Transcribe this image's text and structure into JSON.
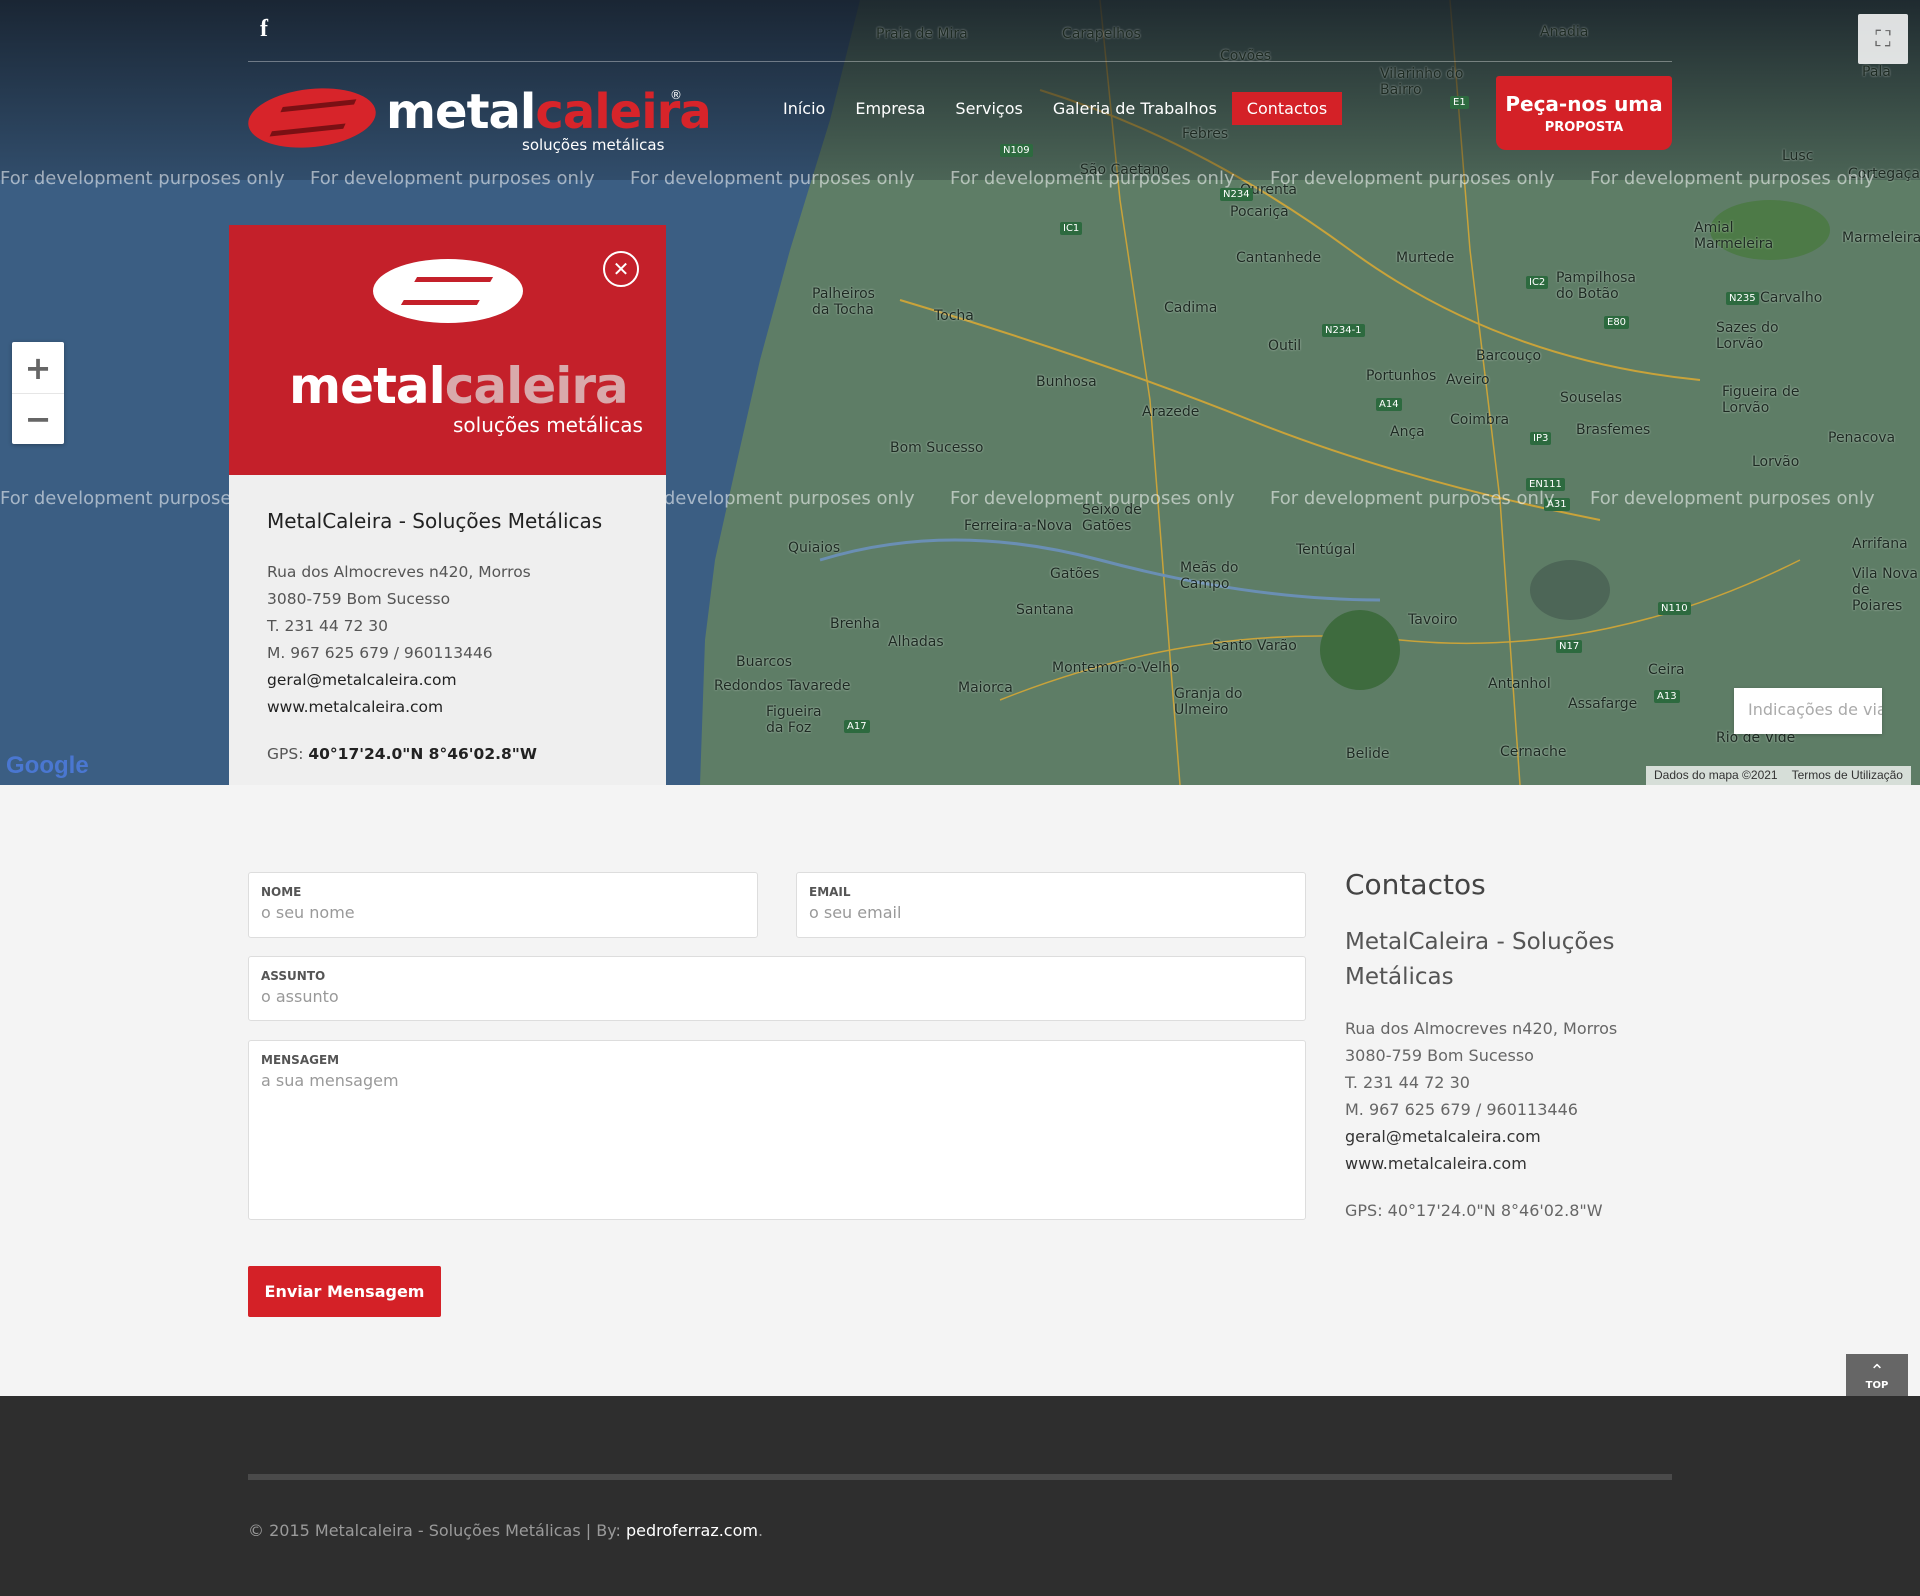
{
  "topbar": {
    "facebook_icon": "f"
  },
  "logo": {
    "word1": "metal",
    "word2": "caleira",
    "reg": "®",
    "sub": "soluções metálicas"
  },
  "nav": {
    "items": [
      {
        "label": "Início"
      },
      {
        "label": "Empresa"
      },
      {
        "label": "Serviços"
      },
      {
        "label": "Galeria de Trabalhos"
      },
      {
        "label": "Contactos"
      }
    ]
  },
  "cta": {
    "line1": "Peça-nos uma",
    "line2": "PROPOSTA"
  },
  "map": {
    "watermark": "For development purposes only",
    "zoom_in": "+",
    "zoom_out": "−",
    "fullscreen_icon": "⛶",
    "google": "Google",
    "directions_placeholder": "Indicações de viagem",
    "credits": "Dados do mapa ©2021",
    "terms": "Termos de Utilização",
    "places": [
      "Praia de Mira",
      "Carapelhos",
      "Anadia",
      "Covões",
      "Vilarinho do Bairro",
      "Pala",
      "Febres",
      "São Caetano",
      "Ourenta",
      "Pocariça",
      "Cantanhede",
      "Murtede",
      "Lusc",
      "Cortegaça",
      "Amial Marmeleira",
      "Marmeleira",
      "Palheiros da Tocha",
      "Tocha",
      "Cadima",
      "Pampilhosa do Botão",
      "Carvalho",
      "Sazes do Lorvão",
      "Outil",
      "Barcouço",
      "Bunhosa",
      "Portunhos",
      "Aveiro",
      "Souselas",
      "Figueira de Lorvão",
      "Arazede",
      "Coimbra",
      "Ança",
      "Brasfemes",
      "Penacova",
      "Lorvão",
      "Bom Sucesso",
      "Ferreira-a-Nova",
      "Seixo de Gatões",
      "Quiaios",
      "Tentúgal",
      "Arrifana",
      "Meãs do Campo",
      "Gatões",
      "Vila Nova de Poiares",
      "Santana",
      "Brenha",
      "Alhadas",
      "Tavoiro",
      "Buarcos",
      "Redondos Tavarede",
      "Maiorca",
      "Montemor-o-Velho",
      "Santo Varão",
      "Antanhol",
      "Assafarge",
      "Ceira",
      "Figueira da Foz",
      "Granja do Ulmeiro",
      "Belide",
      "Cernache",
      "Rio de Vide"
    ],
    "roads": [
      "N109",
      "N234",
      "IC1",
      "N234-1",
      "A14",
      "IP3",
      "E1",
      "IC2",
      "EN111",
      "N110",
      "A31",
      "N17",
      "A13",
      "A17",
      "N235",
      "E80"
    ]
  },
  "infobox": {
    "title": "MetalCaleira - Soluções Metálicas",
    "address1": "Rua dos Almocreves n420, Morros",
    "address2": "3080-759 Bom Sucesso",
    "phone": "T. 231 44 72 30",
    "mobile": "M. 967 625 679 / 960113446",
    "email": "geral@metalcaleira.com",
    "web": "www.metalcaleira.com",
    "gps_label": "GPS:",
    "gps_value": "40°17'24.0\"N 8°46'02.8\"W",
    "close_icon": "✕",
    "logo_word1": "metal",
    "logo_word2": "caleira",
    "logo_sub": "soluções metálicas"
  },
  "form": {
    "name_label": "NOME",
    "name_placeholder": "o seu nome",
    "email_label": "EMAIL",
    "email_placeholder": "o seu email",
    "subject_label": "ASSUNTO",
    "subject_placeholder": "o assunto",
    "message_label": "MENSAGEM",
    "message_placeholder": "a sua mensagem",
    "submit": "Enviar Mensagem"
  },
  "contacts": {
    "heading": "Contactos",
    "company": "MetalCaleira - Soluções Metálicas",
    "address1": "Rua dos Almocreves n420, Morros",
    "address2": "3080-759 Bom Sucesso",
    "phone": "T. 231 44 72 30",
    "mobile": "M. 967 625 679 / 960113446",
    "email": "geral@metalcaleira.com",
    "web": "www.metalcaleira.com",
    "gps": "GPS: 40°17'24.0\"N 8°46'02.8\"W"
  },
  "totop": {
    "arrow": "⌃",
    "label": "TOP"
  },
  "footer": {
    "copy": "© 2015 Metalcaleira - Soluções Metálicas | By: ",
    "author": "pedroferraz.com",
    "dot": "."
  },
  "colors": {
    "accent": "#d42127",
    "footer": "#2e2e2e",
    "background": "#f4f4f4"
  }
}
